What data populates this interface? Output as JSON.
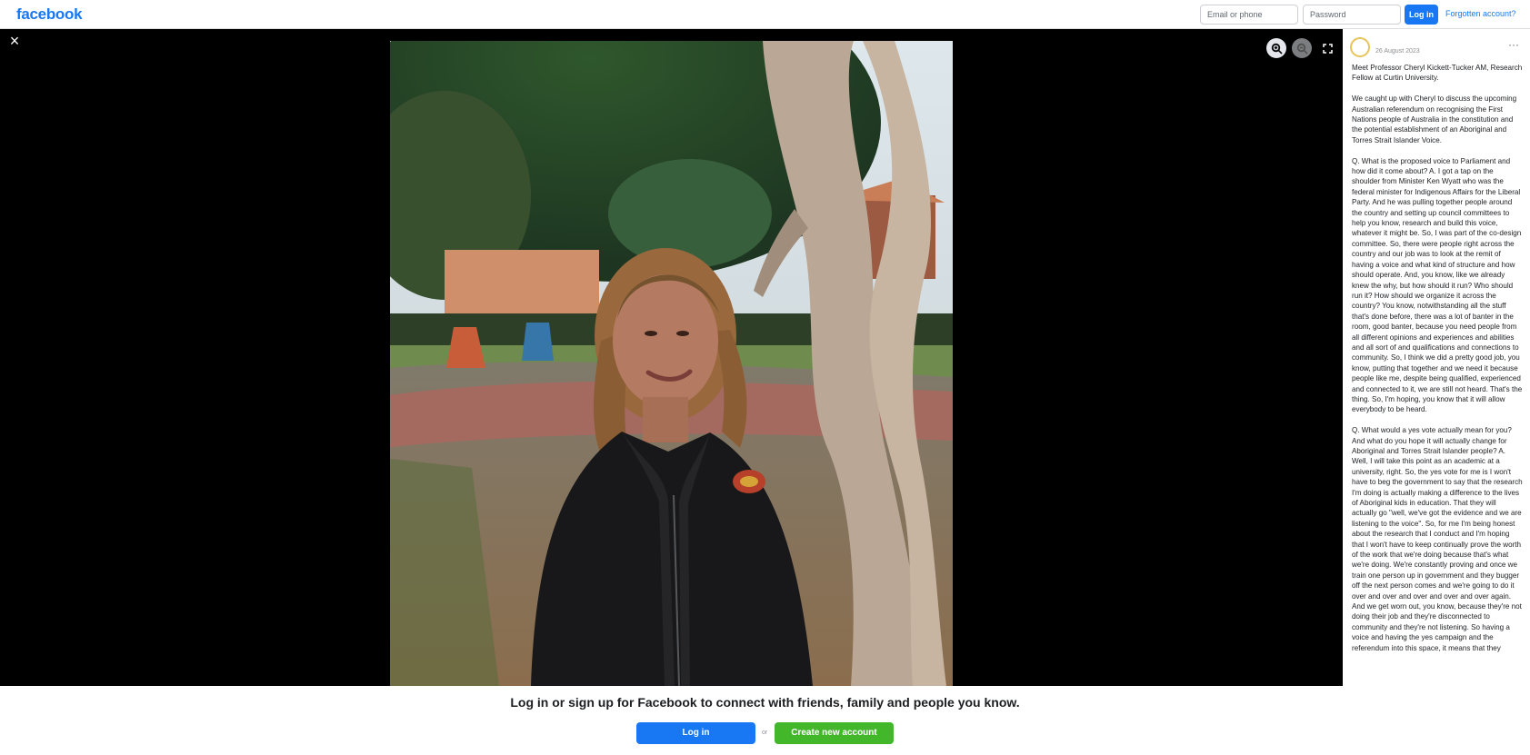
{
  "header": {
    "logo": "facebook",
    "email_placeholder": "Email or phone",
    "password_placeholder": "Password",
    "login_label": "Log in",
    "forgot_label": "Forgotten account?"
  },
  "viewer": {
    "close_label": "×",
    "photo_alt": "Professor Cheryl Kickett-Tucker AM"
  },
  "post": {
    "date": "26 August 2023",
    "more_label": "···",
    "paragraphs": [
      "Meet Professor Cheryl Kickett-Tucker AM, Research Fellow at Curtin University.",
      "We caught up with Cheryl to discuss the upcoming Australian referendum on recognising the First Nations people of Australia in the constitution and the potential establishment of an Aboriginal and Torres Strait Islander Voice.",
      "Q. What is the proposed voice to Parliament and how did it come about? A. I got a tap on the shoulder from Minister Ken Wyatt who was the federal minister for Indigenous Affairs for the Liberal Party. And he was pulling together people around the country and setting up council committees to help you know, research and build this voice, whatever it might be. So, I was part of the co-design committee. So, there were people right across the country and our job was to look at the remit of having a voice and what kind of structure and how should operate. And, you know, like we already knew the why, but how should it run? Who should run it? How should we organize it across the country? You know, notwithstanding all the stuff that's done before, there was a lot of banter in the room, good banter, because you need people from all different opinions and experiences and abilities and all sort of and qualifications and connections to community. So, I think we did a pretty good job, you know, putting that together and we need it because people like me, despite being qualified, experienced and connected to it, we are still not heard. That's the thing. So, I'm hoping, you know that it will allow everybody to be heard.",
      "Q. What would a yes vote actually mean for you? And what do you hope it will actually change for Aboriginal and Torres Strait Islander people? A. Well, I will take this point as an academic at a university, right. So, the yes vote for me is I won't have to beg the government to say that the research I'm doing is actually making a difference to the lives of Aboriginal kids in education. That they will actually go \"well, we've got the evidence and we are listening to the voice\". So, for me I'm being honest about the research that I conduct and I'm hoping that I won't have to keep continually prove the worth of the work that we're doing because that's what we're doing. We're constantly proving and once we train one person up in government and they bugger off the next person comes and we're going to do it over and over and over and over and over again. And we get worn out, you know, because they're not doing their job and they're disconnected to community and they're not listening. So having a voice and having the yes campaign and the referendum into this space, it means that they"
    ]
  },
  "signup": {
    "prompt": "Log in or sign up for Facebook to connect with friends, family and people you know.",
    "login_label": "Log in",
    "or_label": "or",
    "create_label": "Create new account"
  }
}
